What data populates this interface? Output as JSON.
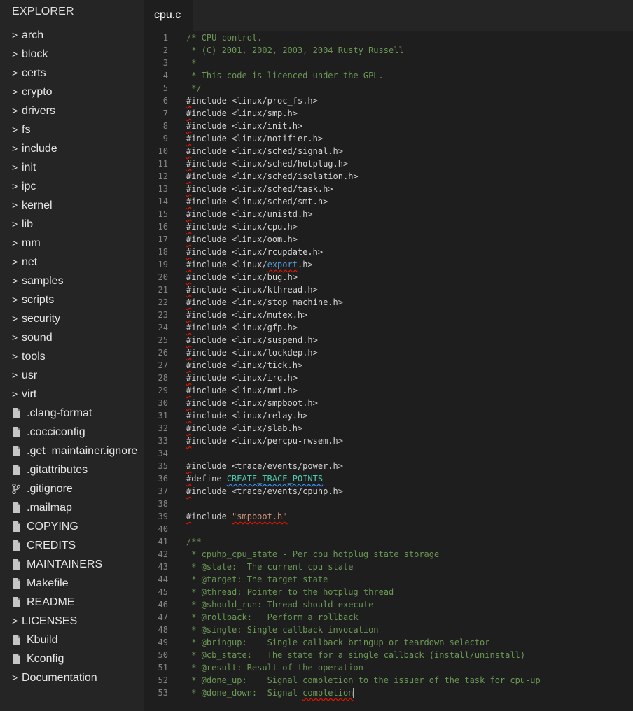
{
  "sidebar": {
    "title": "EXPLORER",
    "items": [
      {
        "type": "folder",
        "label": "arch",
        "icon": "chevron-right-icon"
      },
      {
        "type": "folder",
        "label": "block",
        "icon": "chevron-right-icon"
      },
      {
        "type": "folder",
        "label": "certs",
        "icon": "chevron-right-icon"
      },
      {
        "type": "folder",
        "label": "crypto",
        "icon": "chevron-right-icon"
      },
      {
        "type": "folder",
        "label": "drivers",
        "icon": "chevron-right-icon"
      },
      {
        "type": "folder",
        "label": "fs",
        "icon": "chevron-right-icon"
      },
      {
        "type": "folder",
        "label": "include",
        "icon": "chevron-right-icon"
      },
      {
        "type": "folder",
        "label": "init",
        "icon": "chevron-right-icon"
      },
      {
        "type": "folder",
        "label": "ipc",
        "icon": "chevron-right-icon"
      },
      {
        "type": "folder",
        "label": "kernel",
        "icon": "chevron-right-icon"
      },
      {
        "type": "folder",
        "label": "lib",
        "icon": "chevron-right-icon"
      },
      {
        "type": "folder",
        "label": "mm",
        "icon": "chevron-right-icon"
      },
      {
        "type": "folder",
        "label": "net",
        "icon": "chevron-right-icon"
      },
      {
        "type": "folder",
        "label": "samples",
        "icon": "chevron-right-icon"
      },
      {
        "type": "folder",
        "label": "scripts",
        "icon": "chevron-right-icon"
      },
      {
        "type": "folder",
        "label": "security",
        "icon": "chevron-right-icon"
      },
      {
        "type": "folder",
        "label": "sound",
        "icon": "chevron-right-icon"
      },
      {
        "type": "folder",
        "label": "tools",
        "icon": "chevron-right-icon"
      },
      {
        "type": "folder",
        "label": "usr",
        "icon": "chevron-right-icon"
      },
      {
        "type": "folder",
        "label": "virt",
        "icon": "chevron-right-icon"
      },
      {
        "type": "file",
        "label": ".clang-format",
        "icon": "file-icon"
      },
      {
        "type": "file",
        "label": ".cocciconfig",
        "icon": "file-icon"
      },
      {
        "type": "file",
        "label": ".get_maintainer.ignore",
        "icon": "file-icon"
      },
      {
        "type": "file",
        "label": ".gitattributes",
        "icon": "file-icon"
      },
      {
        "type": "file",
        "label": ".gitignore",
        "icon": "git-branch-icon"
      },
      {
        "type": "file",
        "label": ".mailmap",
        "icon": "file-icon"
      },
      {
        "type": "file",
        "label": "COPYING",
        "icon": "file-icon"
      },
      {
        "type": "file",
        "label": "CREDITS",
        "icon": "file-icon"
      },
      {
        "type": "file",
        "label": "MAINTAINERS",
        "icon": "file-icon"
      },
      {
        "type": "file",
        "label": "Makefile",
        "icon": "file-icon"
      },
      {
        "type": "file",
        "label": "README",
        "icon": "file-icon"
      },
      {
        "type": "folder",
        "label": "LICENSES",
        "icon": "chevron-right-icon"
      },
      {
        "type": "file",
        "label": "Kbuild",
        "icon": "file-icon"
      },
      {
        "type": "file",
        "label": "Kconfig",
        "icon": "file-icon"
      },
      {
        "type": "folder",
        "label": "Documentation",
        "icon": "chevron-right-icon"
      }
    ]
  },
  "editor": {
    "tab_label": "cpu.c",
    "lines": [
      {
        "n": "1",
        "segs": [
          {
            "c": "cm",
            "t": "/* CPU control."
          }
        ]
      },
      {
        "n": "2",
        "segs": [
          {
            "c": "cm",
            "t": " * (C) 2001, 2002, 2003, 2004 Rusty Russell"
          }
        ]
      },
      {
        "n": "3",
        "segs": [
          {
            "c": "cm",
            "t": " *"
          }
        ]
      },
      {
        "n": "4",
        "segs": [
          {
            "c": "cm",
            "t": " * This code is licenced under the GPL."
          }
        ]
      },
      {
        "n": "5",
        "segs": [
          {
            "c": "cm",
            "t": " */"
          }
        ]
      },
      {
        "n": "6",
        "segs": [
          {
            "c": "hash",
            "t": "#"
          },
          {
            "c": "kw",
            "t": "include "
          },
          {
            "c": "inc",
            "t": "<linux/proc_fs.h>"
          }
        ]
      },
      {
        "n": "7",
        "segs": [
          {
            "c": "hash",
            "t": "#"
          },
          {
            "c": "kw",
            "t": "include "
          },
          {
            "c": "inc",
            "t": "<linux/smp.h>"
          }
        ]
      },
      {
        "n": "8",
        "segs": [
          {
            "c": "hash",
            "t": "#"
          },
          {
            "c": "kw",
            "t": "include "
          },
          {
            "c": "inc",
            "t": "<linux/init.h>"
          }
        ]
      },
      {
        "n": "9",
        "segs": [
          {
            "c": "hash",
            "t": "#"
          },
          {
            "c": "kw",
            "t": "include "
          },
          {
            "c": "inc",
            "t": "<linux/notifier.h>"
          }
        ]
      },
      {
        "n": "10",
        "segs": [
          {
            "c": "hash",
            "t": "#"
          },
          {
            "c": "kw",
            "t": "include "
          },
          {
            "c": "inc",
            "t": "<linux/sched/signal.h>"
          }
        ]
      },
      {
        "n": "11",
        "segs": [
          {
            "c": "hash",
            "t": "#"
          },
          {
            "c": "kw",
            "t": "include "
          },
          {
            "c": "inc",
            "t": "<linux/sched/hotplug.h>"
          }
        ]
      },
      {
        "n": "12",
        "segs": [
          {
            "c": "hash",
            "t": "#"
          },
          {
            "c": "kw",
            "t": "include "
          },
          {
            "c": "inc",
            "t": "<linux/sched/isolation.h>"
          }
        ]
      },
      {
        "n": "13",
        "segs": [
          {
            "c": "hash",
            "t": "#"
          },
          {
            "c": "kw",
            "t": "include "
          },
          {
            "c": "inc",
            "t": "<linux/sched/task.h>"
          }
        ]
      },
      {
        "n": "14",
        "segs": [
          {
            "c": "hash",
            "t": "#"
          },
          {
            "c": "kw",
            "t": "include "
          },
          {
            "c": "inc",
            "t": "<linux/sched/smt.h>"
          }
        ]
      },
      {
        "n": "15",
        "segs": [
          {
            "c": "hash",
            "t": "#"
          },
          {
            "c": "kw",
            "t": "include "
          },
          {
            "c": "inc",
            "t": "<linux/unistd.h>"
          }
        ]
      },
      {
        "n": "16",
        "segs": [
          {
            "c": "hash",
            "t": "#"
          },
          {
            "c": "kw",
            "t": "include "
          },
          {
            "c": "inc",
            "t": "<linux/cpu.h>"
          }
        ]
      },
      {
        "n": "17",
        "segs": [
          {
            "c": "hash",
            "t": "#"
          },
          {
            "c": "kw",
            "t": "include "
          },
          {
            "c": "inc",
            "t": "<linux/oom.h>"
          }
        ]
      },
      {
        "n": "18",
        "segs": [
          {
            "c": "hash",
            "t": "#"
          },
          {
            "c": "kw",
            "t": "include "
          },
          {
            "c": "inc",
            "t": "<linux/rcupdate.h>"
          }
        ]
      },
      {
        "n": "19",
        "segs": [
          {
            "c": "hash",
            "t": "#"
          },
          {
            "c": "kw",
            "t": "include "
          },
          {
            "c": "inc",
            "t": "<linux/"
          },
          {
            "c": "exp",
            "t": "export"
          },
          {
            "c": "inc",
            "t": ".h>"
          }
        ]
      },
      {
        "n": "20",
        "segs": [
          {
            "c": "hash",
            "t": "#"
          },
          {
            "c": "kw",
            "t": "include "
          },
          {
            "c": "inc",
            "t": "<linux/bug.h>"
          }
        ]
      },
      {
        "n": "21",
        "segs": [
          {
            "c": "hash",
            "t": "#"
          },
          {
            "c": "kw",
            "t": "include "
          },
          {
            "c": "inc",
            "t": "<linux/kthread.h>"
          }
        ]
      },
      {
        "n": "22",
        "segs": [
          {
            "c": "hash",
            "t": "#"
          },
          {
            "c": "kw",
            "t": "include "
          },
          {
            "c": "inc",
            "t": "<linux/stop_machine.h>"
          }
        ]
      },
      {
        "n": "23",
        "segs": [
          {
            "c": "hash",
            "t": "#"
          },
          {
            "c": "kw",
            "t": "include "
          },
          {
            "c": "inc",
            "t": "<linux/mutex.h>"
          }
        ]
      },
      {
        "n": "24",
        "segs": [
          {
            "c": "hash",
            "t": "#"
          },
          {
            "c": "kw",
            "t": "include "
          },
          {
            "c": "inc",
            "t": "<linux/gfp.h>"
          }
        ]
      },
      {
        "n": "25",
        "segs": [
          {
            "c": "hash",
            "t": "#"
          },
          {
            "c": "kw",
            "t": "include "
          },
          {
            "c": "inc",
            "t": "<linux/suspend.h>"
          }
        ]
      },
      {
        "n": "26",
        "segs": [
          {
            "c": "hash",
            "t": "#"
          },
          {
            "c": "kw",
            "t": "include "
          },
          {
            "c": "inc",
            "t": "<linux/lockdep.h>"
          }
        ]
      },
      {
        "n": "27",
        "segs": [
          {
            "c": "hash",
            "t": "#"
          },
          {
            "c": "kw",
            "t": "include "
          },
          {
            "c": "inc",
            "t": "<linux/tick.h>"
          }
        ]
      },
      {
        "n": "28",
        "segs": [
          {
            "c": "hash",
            "t": "#"
          },
          {
            "c": "kw",
            "t": "include "
          },
          {
            "c": "inc",
            "t": "<linux/irq.h>"
          }
        ]
      },
      {
        "n": "29",
        "segs": [
          {
            "c": "hash",
            "t": "#"
          },
          {
            "c": "kw",
            "t": "include "
          },
          {
            "c": "inc",
            "t": "<linux/nmi.h>"
          }
        ]
      },
      {
        "n": "30",
        "segs": [
          {
            "c": "hash",
            "t": "#"
          },
          {
            "c": "kw",
            "t": "include "
          },
          {
            "c": "inc",
            "t": "<linux/smpboot.h>"
          }
        ]
      },
      {
        "n": "31",
        "segs": [
          {
            "c": "hash",
            "t": "#"
          },
          {
            "c": "kw",
            "t": "include "
          },
          {
            "c": "inc",
            "t": "<linux/relay.h>"
          }
        ]
      },
      {
        "n": "32",
        "segs": [
          {
            "c": "hash",
            "t": "#"
          },
          {
            "c": "kw",
            "t": "include "
          },
          {
            "c": "inc",
            "t": "<linux/slab.h>"
          }
        ]
      },
      {
        "n": "33",
        "segs": [
          {
            "c": "hash",
            "t": "#"
          },
          {
            "c": "kw",
            "t": "include "
          },
          {
            "c": "inc",
            "t": "<linux/percpu-rwsem.h>"
          }
        ]
      },
      {
        "n": "34",
        "segs": []
      },
      {
        "n": "35",
        "segs": [
          {
            "c": "hash",
            "t": "#"
          },
          {
            "c": "kw",
            "t": "include "
          },
          {
            "c": "inc",
            "t": "<trace/events/power.h>"
          }
        ]
      },
      {
        "n": "36",
        "segs": [
          {
            "c": "hash",
            "t": "#"
          },
          {
            "c": "kw",
            "t": "define "
          },
          {
            "c": "macro",
            "t": "CREATE_TRACE_POINTS"
          }
        ]
      },
      {
        "n": "37",
        "segs": [
          {
            "c": "hash",
            "t": "#"
          },
          {
            "c": "kw",
            "t": "include "
          },
          {
            "c": "inc",
            "t": "<trace/events/cpuhp.h>"
          }
        ]
      },
      {
        "n": "38",
        "segs": []
      },
      {
        "n": "39",
        "segs": [
          {
            "c": "hash",
            "t": "#"
          },
          {
            "c": "kw",
            "t": "include "
          },
          {
            "c": "str",
            "t": "\"smpboot.h\""
          }
        ]
      },
      {
        "n": "40",
        "segs": []
      },
      {
        "n": "41",
        "segs": [
          {
            "c": "cm",
            "t": "/**"
          }
        ]
      },
      {
        "n": "42",
        "segs": [
          {
            "c": "cm",
            "t": " * cpuhp_cpu_state - Per cpu hotplug state storage"
          }
        ]
      },
      {
        "n": "43",
        "segs": [
          {
            "c": "cm",
            "t": " * @state:  The current cpu state"
          }
        ]
      },
      {
        "n": "44",
        "segs": [
          {
            "c": "cm",
            "t": " * @target: The target state"
          }
        ]
      },
      {
        "n": "45",
        "segs": [
          {
            "c": "cm",
            "t": " * @thread: Pointer to the hotplug thread"
          }
        ]
      },
      {
        "n": "46",
        "segs": [
          {
            "c": "cm",
            "t": " * @should_run: Thread should execute"
          }
        ]
      },
      {
        "n": "47",
        "segs": [
          {
            "c": "cm",
            "t": " * @rollback:   Perform a rollback"
          }
        ]
      },
      {
        "n": "48",
        "segs": [
          {
            "c": "cm",
            "t": " * @single: Single callback invocation"
          }
        ]
      },
      {
        "n": "49",
        "segs": [
          {
            "c": "cm",
            "t": " * @bringup:    Single callback bringup or teardown selector"
          }
        ]
      },
      {
        "n": "50",
        "segs": [
          {
            "c": "cm",
            "t": " * @cb_state:   The state for a single callback (install/uninstall)"
          }
        ]
      },
      {
        "n": "51",
        "segs": [
          {
            "c": "cm",
            "t": " * @result: Result of the operation"
          }
        ]
      },
      {
        "n": "52",
        "segs": [
          {
            "c": "cm",
            "t": " * @done_up:    Signal completion to the issuer of the task for cpu-up"
          }
        ]
      },
      {
        "n": "53",
        "segs": [
          {
            "c": "cm",
            "t": " * @done_down:  Signal "
          },
          {
            "c": "cm sq",
            "t": "completion"
          },
          {
            "c": "caret",
            "t": ""
          }
        ]
      }
    ]
  }
}
